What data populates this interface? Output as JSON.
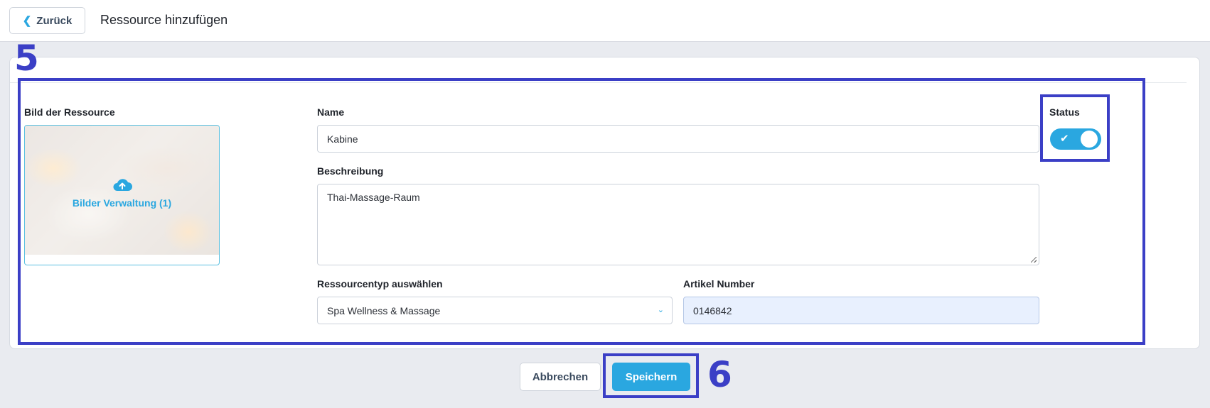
{
  "header": {
    "back_label": "Zurück",
    "title": "Ressource hinzufügen"
  },
  "annotations": {
    "section_number": "5",
    "save_number": "6"
  },
  "form": {
    "image": {
      "label": "Bild der Ressource",
      "manage_label": "Bilder Verwaltung (1)"
    },
    "name": {
      "label": "Name",
      "value": "Kabine"
    },
    "description": {
      "label": "Beschreibung",
      "value": "Thai-Massage-Raum"
    },
    "resource_type": {
      "label": "Ressourcentyp auswählen",
      "selected": "Spa Wellness & Massage"
    },
    "article_number": {
      "label": "Artikel Number",
      "value": "0146842"
    },
    "status": {
      "label": "Status",
      "enabled": true
    }
  },
  "actions": {
    "cancel_label": "Abbrechen",
    "save_label": "Speichern"
  },
  "colors": {
    "accent": "#2aa7e0",
    "annotation": "#3b3fc6",
    "background": "#e9ebf0"
  }
}
